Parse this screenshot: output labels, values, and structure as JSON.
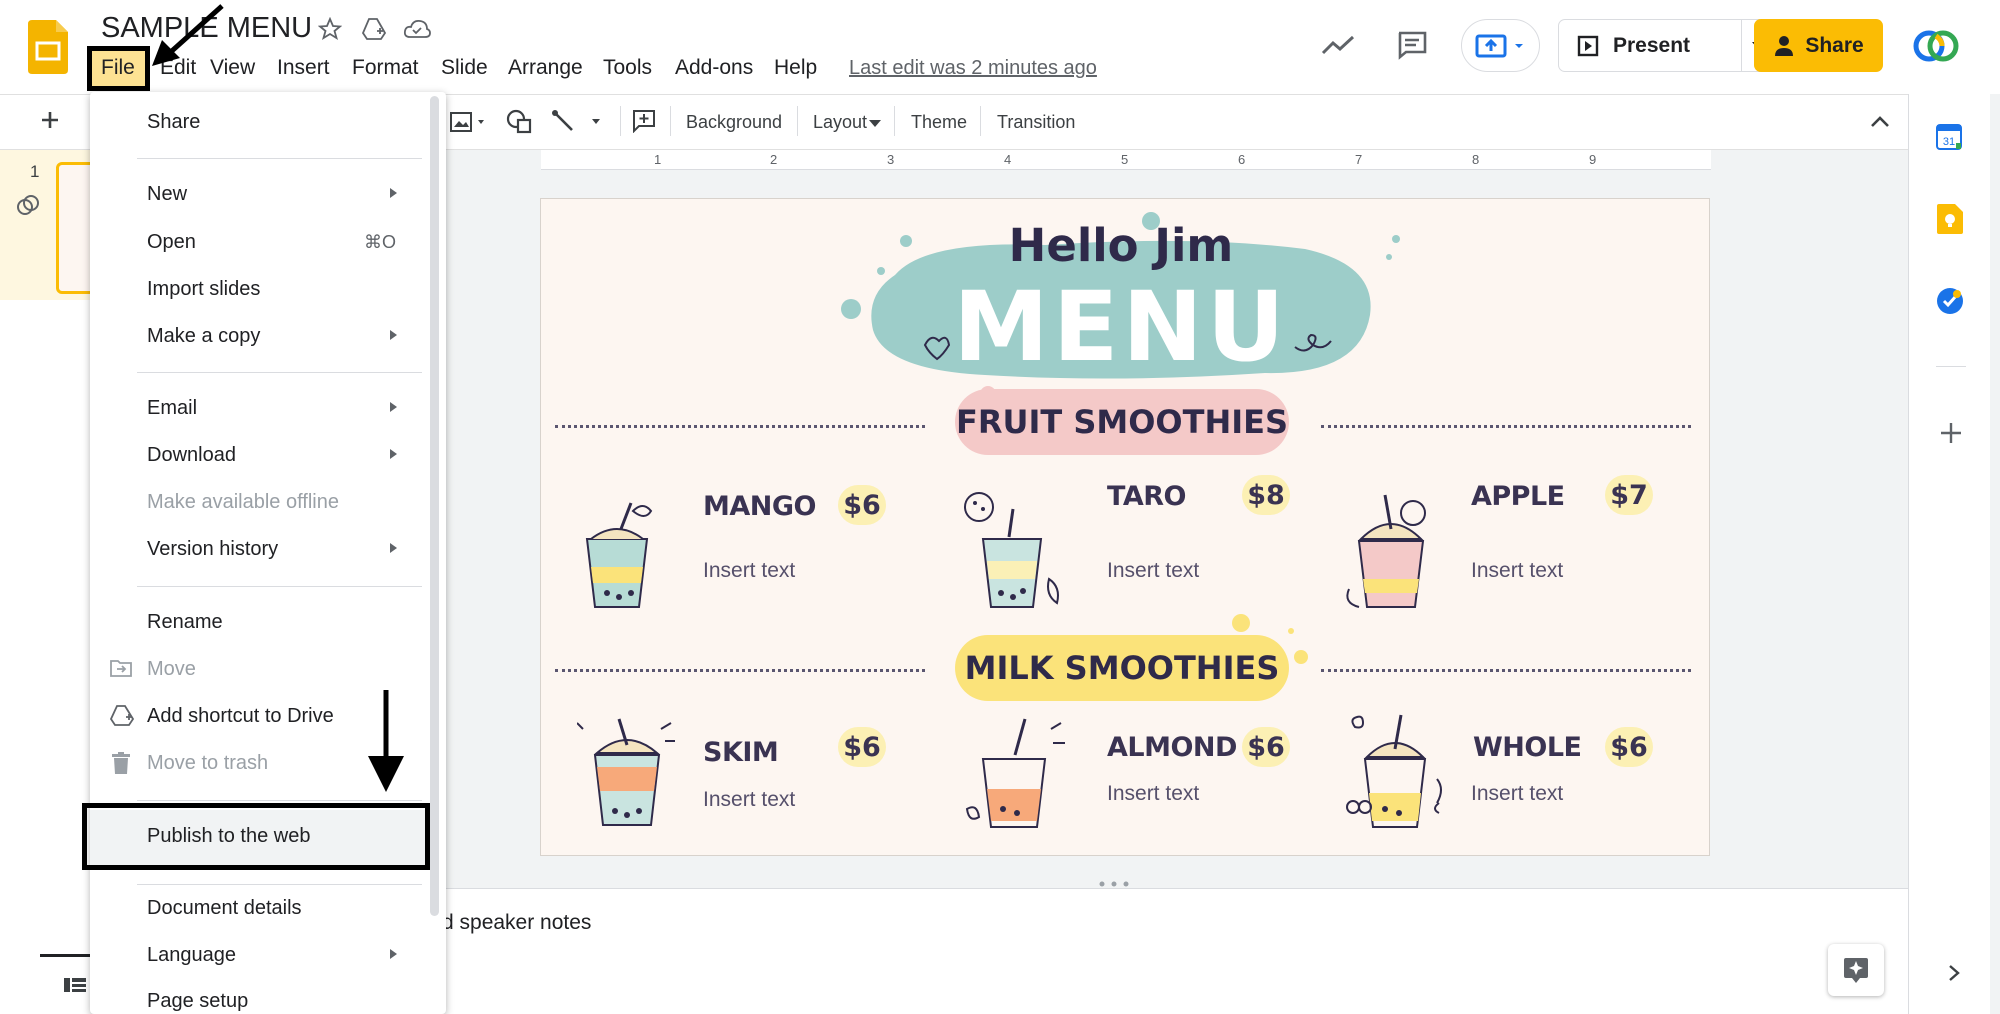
{
  "app": {
    "title": "SAMPLE MENU",
    "last_edit": "Last edit was 2 minutes ago"
  },
  "menubar": [
    "File",
    "Edit",
    "View",
    "Insert",
    "Format",
    "Slide",
    "Arrange",
    "Tools",
    "Add-ons",
    "Help"
  ],
  "header": {
    "present_label": "Present",
    "share_label": "Share"
  },
  "toolbar": {
    "background_label": "Background",
    "layout_label": "Layout",
    "theme_label": "Theme",
    "transition_label": "Transition"
  },
  "ruler": [
    "1",
    "2",
    "3",
    "4",
    "5",
    "6",
    "7",
    "8",
    "9"
  ],
  "filmstrip": {
    "slide_number": "1"
  },
  "slide": {
    "greeting": "Hello Jim",
    "title": "MENU",
    "section1": "FRUIT SMOOTHIES",
    "section2": "MILK SMOOTHIES",
    "items": [
      {
        "name": "MANGO",
        "price": "$6",
        "text": "Insert text"
      },
      {
        "name": "TARO",
        "price": "$8",
        "text": "Insert text"
      },
      {
        "name": "APPLE",
        "price": "$7",
        "text": "Insert text"
      },
      {
        "name": "SKIM",
        "price": "$6",
        "text": "Insert text"
      },
      {
        "name": "ALMOND",
        "price": "$6",
        "text": "Insert text"
      },
      {
        "name": "WHOLE",
        "price": "$6",
        "text": "Insert text"
      }
    ],
    "colors": {
      "teal": "#9dcdc9",
      "pink": "#f4c9c8",
      "yellow": "#fbe37a",
      "dark": "#2f2a4a"
    }
  },
  "notes": {
    "text": "d speaker notes"
  },
  "file_menu": {
    "share": "Share",
    "new": "New",
    "open": "Open",
    "open_shortcut": "⌘O",
    "import_slides": "Import slides",
    "make_copy": "Make a copy",
    "email": "Email",
    "download": "Download",
    "make_offline": "Make available offline",
    "version_history": "Version history",
    "rename": "Rename",
    "move": "Move",
    "add_shortcut": "Add shortcut to Drive",
    "move_trash": "Move to trash",
    "publish": "Publish to the web",
    "document_details": "Document details",
    "language": "Language",
    "page_setup": "Page setup"
  },
  "icons": {
    "accent_yellow": "#fbbc04",
    "present_blue": "#1a73e8"
  }
}
